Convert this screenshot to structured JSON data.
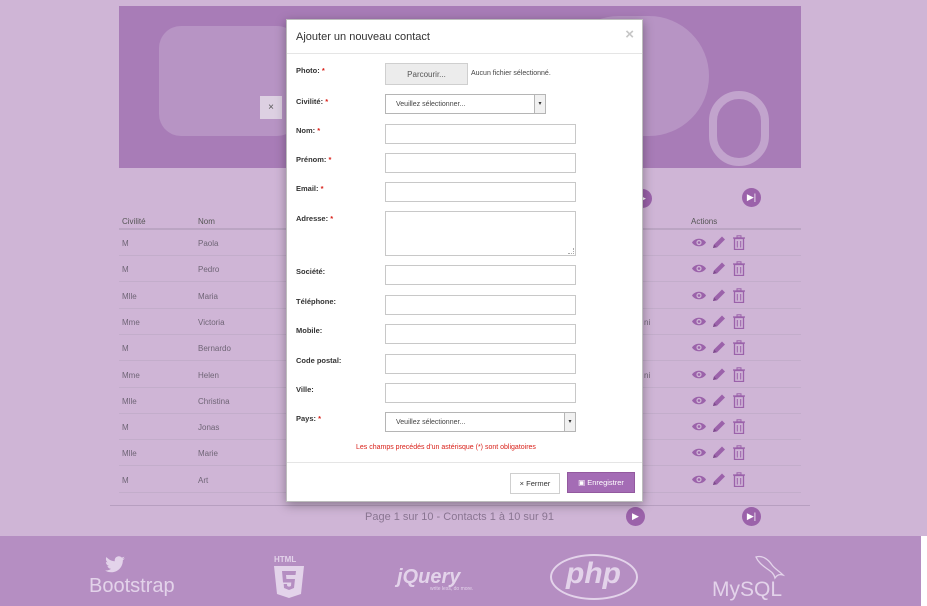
{
  "modal": {
    "title": "Ajouter un nouveau contact",
    "close_symbol": "×",
    "required_mark": "*",
    "fields": {
      "photo": {
        "label": "Photo:",
        "browse_label": "Parcourir...",
        "no_file": "Aucun fichier sélectionné."
      },
      "civilite": {
        "label": "Civilité:",
        "value": "Veuillez sélectionner..."
      },
      "nom": {
        "label": "Nom:",
        "value": ""
      },
      "prenom": {
        "label": "Prénom:",
        "value": ""
      },
      "email": {
        "label": "Email:",
        "value": ""
      },
      "adresse": {
        "label": "Adresse:",
        "value": ""
      },
      "societe": {
        "label": "Société:",
        "value": ""
      },
      "telephone": {
        "label": "Téléphone:",
        "value": ""
      },
      "mobile": {
        "label": "Mobile:",
        "value": ""
      },
      "code_postal": {
        "label": "Code postal:",
        "value": ""
      },
      "ville": {
        "label": "Ville:",
        "value": ""
      },
      "pays": {
        "label": "Pays:",
        "value": "Veuillez sélectionner..."
      }
    },
    "required_note": "Les champs precédés d'un astérisque (*) sont obligatoires",
    "buttons": {
      "close": "× Fermer",
      "save": "Enregistrer"
    }
  },
  "background": {
    "hero_close": "×",
    "table": {
      "headers": {
        "civilite": "Civilité",
        "nom": "Nom",
        "actions": "Actions"
      },
      "rows": [
        {
          "civilite": "M",
          "nom": "Paola",
          "extra": ""
        },
        {
          "civilite": "M",
          "nom": "Pedro",
          "extra": ""
        },
        {
          "civilite": "Mlle",
          "nom": "Maria",
          "extra": ""
        },
        {
          "civilite": "Mme",
          "nom": "Victoria",
          "extra": "ni"
        },
        {
          "civilite": "M",
          "nom": "Bernardo",
          "extra": ""
        },
        {
          "civilite": "Mme",
          "nom": "Helen",
          "extra": "ni"
        },
        {
          "civilite": "Mlle",
          "nom": "Christina",
          "extra": ""
        },
        {
          "civilite": "M",
          "nom": "Jonas",
          "extra": ""
        },
        {
          "civilite": "Mlle",
          "nom": "Marie",
          "extra": ""
        },
        {
          "civilite": "M",
          "nom": "Art",
          "extra": ""
        }
      ]
    },
    "pagination": {
      "text": "Page 1 sur 10 - Contacts 1 à 10 sur 91"
    },
    "footer_logos": {
      "bootstrap": "Bootstrap",
      "html5": "HTML",
      "jquery": "jQuery",
      "jquery_tagline": "write less, do more.",
      "php": "php",
      "mysql": "MySQL"
    },
    "accent_color": "#9b62aa"
  }
}
